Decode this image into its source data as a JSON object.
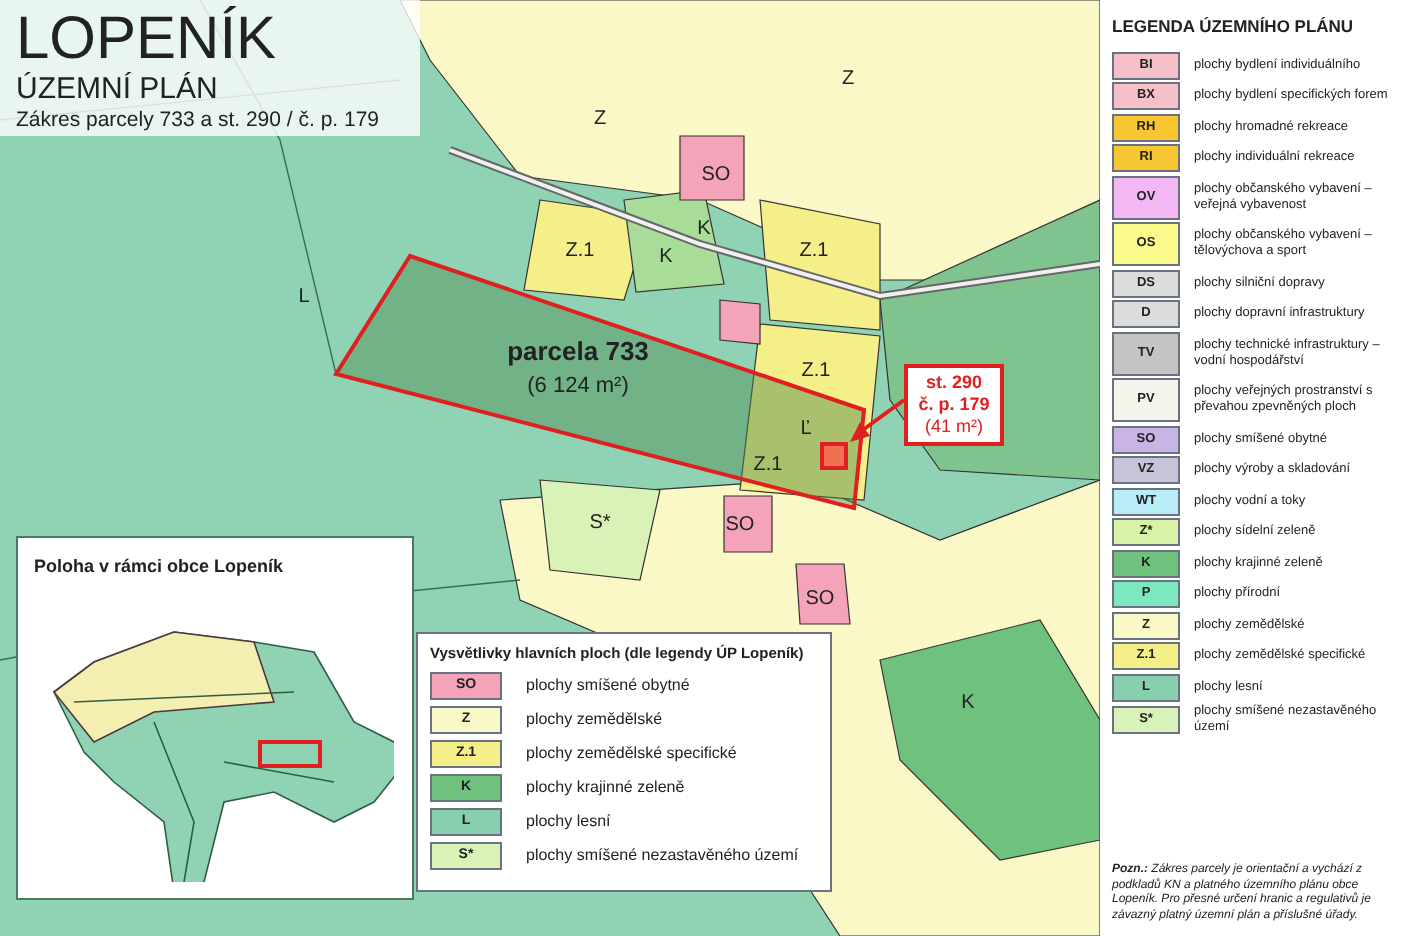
{
  "title": {
    "heading": "LOPENÍK",
    "subtitle": "ÚZEMNÍ PLÁN",
    "caption": "Zákres parcely 733 a st. 290 / č. p. 179"
  },
  "map": {
    "zone_labels": [
      {
        "text": "Z"
      },
      {
        "text": "Z"
      },
      {
        "text": "SO"
      },
      {
        "text": "K"
      },
      {
        "text": "K"
      },
      {
        "text": "Z.1"
      },
      {
        "text": "Z.1"
      },
      {
        "text": "Z.1"
      },
      {
        "text": "L"
      },
      {
        "text": "Ľ"
      },
      {
        "text": "Z.1"
      },
      {
        "text": "S*"
      },
      {
        "text": "SO"
      },
      {
        "text": "SO"
      },
      {
        "text": "K"
      }
    ],
    "parcel": {
      "label": "parcela 733",
      "area": "(6 124 m²)"
    },
    "building_callout": {
      "lines": [
        "st. 290",
        "č. p. 179",
        "(41 m²)"
      ]
    }
  },
  "inset": {
    "title": "Poloha v rámci obce Lopeník"
  },
  "main_legend": {
    "title": "Vysvětlivky hlavních ploch (dle legendy ÚP Lopeník)",
    "items": [
      {
        "code": "SO",
        "label": "plochy smíšené obytné",
        "color": "#f4a3b8"
      },
      {
        "code": "Z",
        "label": "plochy zemědělské",
        "color": "#fbf8c8"
      },
      {
        "code": "Z.1",
        "label": "plochy zemědělské specifické",
        "color": "#f4ef88"
      },
      {
        "code": "K",
        "label": "plochy krajinné zeleně",
        "color": "#6fc27e"
      },
      {
        "code": "L",
        "label": "plochy lesní",
        "color": "#86d0b0"
      },
      {
        "code": "S*",
        "label": "plochy smíšené nezastavěného území",
        "color": "#d8f2b8"
      }
    ]
  },
  "plan_legend": {
    "title": "LEGENDA ÚZEMNÍHO PLÁNU",
    "items": [
      {
        "code": "BI",
        "label": "plochy bydlení individuálního",
        "color": "#f6c0c8"
      },
      {
        "code": "BX",
        "label": "plochy bydlení specifických forem",
        "color": "#f6c0c8"
      },
      {
        "code": "RH",
        "label": "plochy hromadné rekreace",
        "color": "#f7c631"
      },
      {
        "code": "RI",
        "label": "plochy individuální rekreace",
        "color": "#f7c631"
      },
      {
        "code": "OV",
        "label": "plochy občanského vybavení – veřejná vybavenost",
        "color": "#f3b8f3"
      },
      {
        "code": "OS",
        "label": "plochy občanského vybavení – tělovýchova a sport",
        "color": "#fbfa8c"
      },
      {
        "code": "DS",
        "label": "plochy silniční dopravy",
        "color": "#dcdcdc"
      },
      {
        "code": "D",
        "label": "plochy dopravní infrastruktury",
        "color": "#dcdcdc"
      },
      {
        "code": "TV",
        "label": "plochy technické infrastruktury – vodní hospodářství",
        "color": "#c4c4c4"
      },
      {
        "code": "PV",
        "label": "plochy veřejných prostranství s převahou zpevněných ploch",
        "color": "#f4f4ec"
      },
      {
        "code": "SO",
        "label": "plochy smíšené obytné",
        "color": "#c9b4e6"
      },
      {
        "code": "VZ",
        "label": "plochy výroby a skladování",
        "color": "#c8c4d8"
      },
      {
        "code": "WT",
        "label": "plochy vodní a toky",
        "color": "#b8ecf6"
      },
      {
        "code": "Z*",
        "label": "plochy sídelní zeleně",
        "color": "#d8f2a8"
      },
      {
        "code": "K",
        "label": "plochy krajinné zeleně",
        "color": "#6fc27e"
      },
      {
        "code": "P",
        "label": "plochy přírodní",
        "color": "#7de8c0"
      },
      {
        "code": "Z",
        "label": "plochy zemědělské",
        "color": "#fbf8c8"
      },
      {
        "code": "Z.1",
        "label": "plochy zemědělské specifické",
        "color": "#f4ef88"
      },
      {
        "code": "L",
        "label": "plochy lesní",
        "color": "#86d0b0"
      },
      {
        "code": "S*",
        "label": "plochy smíšené nezastavěného území",
        "color": "#d8f2b8"
      }
    ]
  },
  "note": {
    "prefix": "Pozn.:",
    "text": "Zákres parcely je orientační a vychází z podkladů KN a platného územního plánu obce Lopeník. Pro přesné určení hranic a regulativů je závazný platný územní plán a příslušné úřady."
  }
}
